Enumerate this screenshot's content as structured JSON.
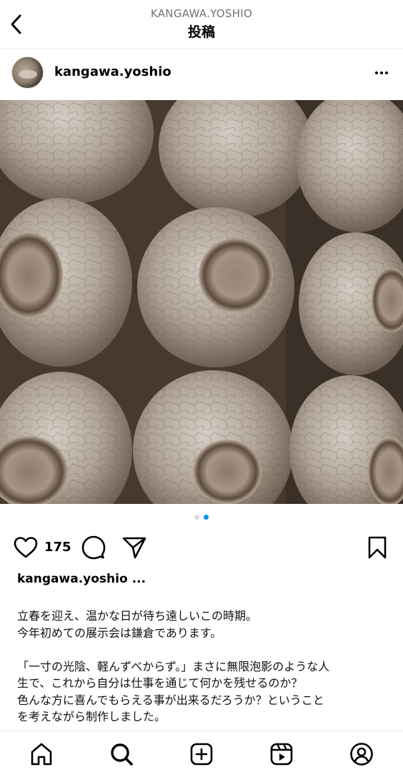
{
  "header": {
    "account": "KANGAWA.YOSHIO",
    "title": "投稿",
    "back_icon": "chevron-left-icon"
  },
  "post": {
    "username": "kangawa.yoshio",
    "more_icon": "more-horizontal-icon",
    "carousel": {
      "total": 2,
      "current": 2
    },
    "likes": "175",
    "caption_user": "kangawa.yoshio",
    "caption_more": "...",
    "caption_lines": [
      "立春を迎え、温かな日が待ち遠しいこの時期。",
      "今年初めての展示会は鎌倉であります。",
      "",
      "「一寸の光陰、軽んずべからず。」まさに無限泡影のような人",
      "生で、これから自分は仕事を通じて何かを残せるのか？",
      "色んな方に喜んでもらえる事が出来るだろうか？ということ",
      "を考えながら制作しました。"
    ]
  },
  "actions": {
    "like_icon": "heart-icon",
    "comment_icon": "comment-icon",
    "share_icon": "paper-plane-icon",
    "save_icon": "bookmark-icon"
  },
  "bottom_nav": [
    {
      "name": "home",
      "icon": "home-icon"
    },
    {
      "name": "search",
      "icon": "search-icon"
    },
    {
      "name": "create",
      "icon": "plus-square-icon"
    },
    {
      "name": "reels",
      "icon": "reels-icon"
    },
    {
      "name": "profile",
      "icon": "profile-icon"
    }
  ],
  "colors": {
    "accent": "#0095f6",
    "text": "#000000",
    "muted": "#737373"
  }
}
